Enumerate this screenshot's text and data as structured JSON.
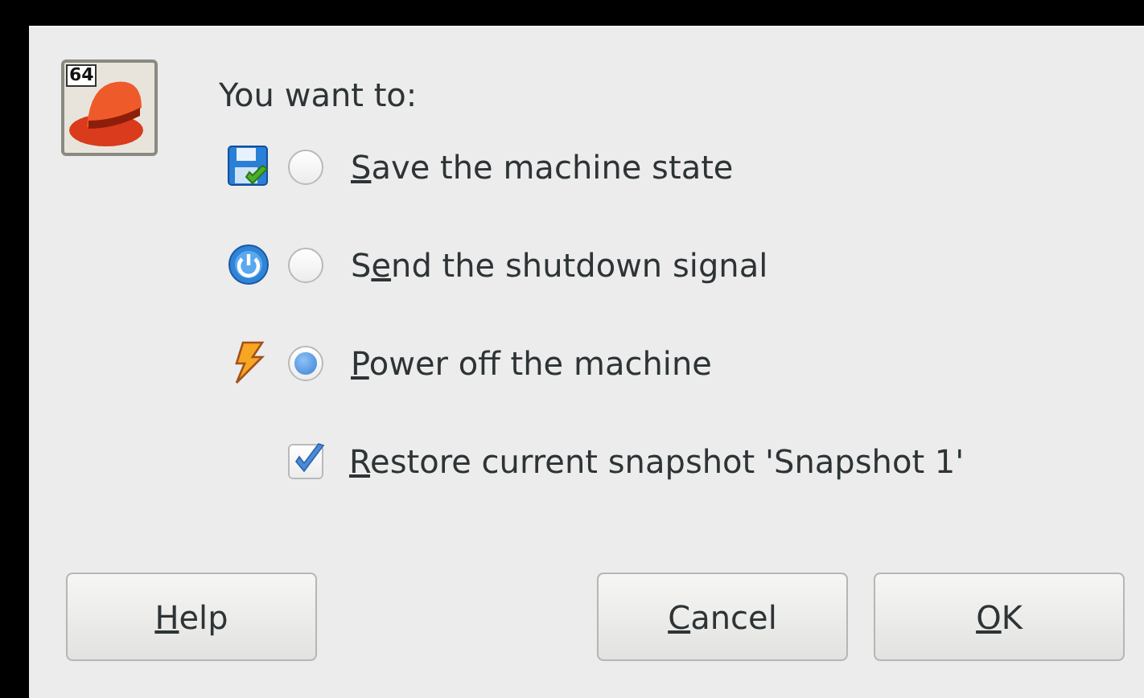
{
  "os_icon": {
    "badge": "64"
  },
  "prompt": "You want to:",
  "options": [
    {
      "kind": "radio",
      "label": "Save the machine state",
      "selected": false
    },
    {
      "kind": "radio",
      "label": "Send the shutdown signal",
      "selected": false
    },
    {
      "kind": "radio",
      "label": "Power off the machine",
      "selected": true
    },
    {
      "kind": "checkbox",
      "label": "Restore current snapshot 'Snapshot 1'",
      "checked": true
    }
  ],
  "buttons": [
    {
      "label": "Help"
    },
    {
      "label": "Cancel"
    },
    {
      "label": "OK"
    }
  ]
}
